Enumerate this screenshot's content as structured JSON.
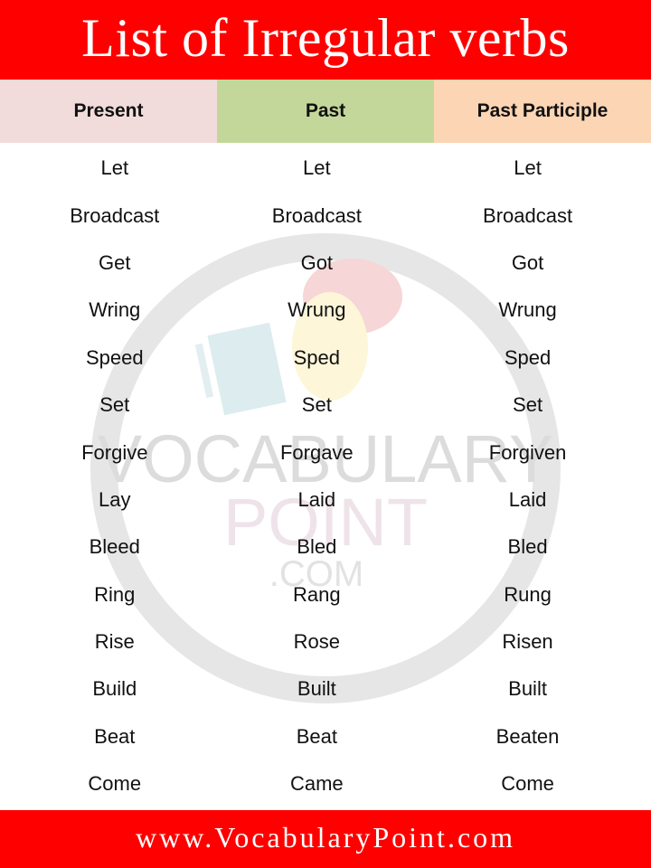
{
  "title": "List of Irregular verbs",
  "colors": {
    "banner": "#fe0000",
    "header_present": "#f2dcdb",
    "header_past": "#c4d79b",
    "header_past_participle": "#fcd5b4"
  },
  "table": {
    "headers": [
      "Present",
      "Past",
      "Past Participle"
    ],
    "rows": [
      [
        "Let",
        "Let",
        "Let"
      ],
      [
        "Broadcast",
        "Broadcast",
        "Broadcast"
      ],
      [
        "Get",
        "Got",
        "Got"
      ],
      [
        "Wring",
        "Wrung",
        "Wrung"
      ],
      [
        "Speed",
        "Sped",
        "Sped"
      ],
      [
        "Set",
        "Set",
        "Set"
      ],
      [
        "Forgive",
        "Forgave",
        "Forgiven"
      ],
      [
        "Lay",
        "Laid",
        "Laid"
      ],
      [
        "Bleed",
        "Bled",
        "Bled"
      ],
      [
        "Ring",
        "Rang",
        "Rung"
      ],
      [
        "Rise",
        "Rose",
        "Risen"
      ],
      [
        "Build",
        "Built",
        "Built"
      ],
      [
        "Beat",
        "Beat",
        "Beaten"
      ],
      [
        "Come",
        "Came",
        "Come"
      ]
    ]
  },
  "watermark": {
    "line1": "VOCABULARY",
    "line2": "POINT",
    "line3": ".COM"
  },
  "footer": "www.VocabularyPoint.com"
}
